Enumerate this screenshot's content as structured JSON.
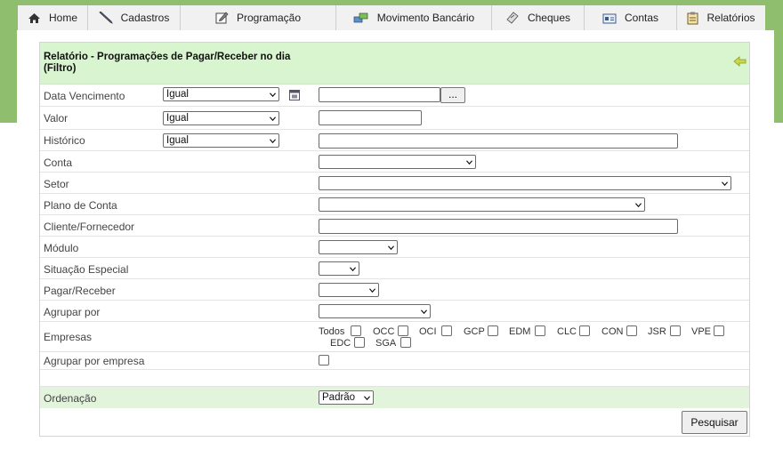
{
  "nav": [
    {
      "label": "Home",
      "icon": "home-icon"
    },
    {
      "label": "Cadastros",
      "icon": "pencil-icon"
    },
    {
      "label": "Programação",
      "icon": "edit-icon"
    },
    {
      "label": "Movimento Bancário",
      "icon": "bank-transfer-icon"
    },
    {
      "label": "Cheques",
      "icon": "cheque-icon"
    },
    {
      "label": "Contas",
      "icon": "accounts-icon"
    },
    {
      "label": "Relatórios",
      "icon": "report-icon"
    }
  ],
  "form": {
    "title": "Relatório - Programações de Pagar/Receber no dia (Filtro)",
    "fields": {
      "data_vencimento": {
        "label": "Data Vencimento",
        "operator": "Igual",
        "value": "",
        "button": "..."
      },
      "valor": {
        "label": "Valor",
        "operator": "Igual",
        "value": ""
      },
      "historico": {
        "label": "Histórico",
        "operator": "Igual",
        "value": ""
      },
      "conta": {
        "label": "Conta",
        "value": ""
      },
      "setor": {
        "label": "Setor",
        "value": ""
      },
      "plano_conta": {
        "label": "Plano de Conta",
        "value": ""
      },
      "cliente_fornecedor": {
        "label": "Cliente/Fornecedor",
        "value": ""
      },
      "modulo": {
        "label": "Módulo",
        "value": ""
      },
      "situacao_especial": {
        "label": "Situação Especial",
        "value": ""
      },
      "pagar_receber": {
        "label": "Pagar/Receber",
        "value": ""
      },
      "agrupar_por": {
        "label": "Agrupar por",
        "value": ""
      },
      "empresas": {
        "label": "Empresas",
        "options": [
          "Todos",
          "OCC",
          "OCI",
          "GCP",
          "EDM",
          "CLC",
          "CON",
          "JSR",
          "VPE",
          "EDC",
          "SGA"
        ]
      },
      "agrupar_por_empresa": {
        "label": "Agrupar por empresa"
      },
      "ordenacao": {
        "label": "Ordenação",
        "value": "Padrão"
      }
    },
    "search_button": "Pesquisar"
  },
  "colors": {
    "green_bg": "#8fbf6e",
    "header_bg": "#d8f5cf",
    "ordenacao_bg": "#e2f4dc"
  }
}
